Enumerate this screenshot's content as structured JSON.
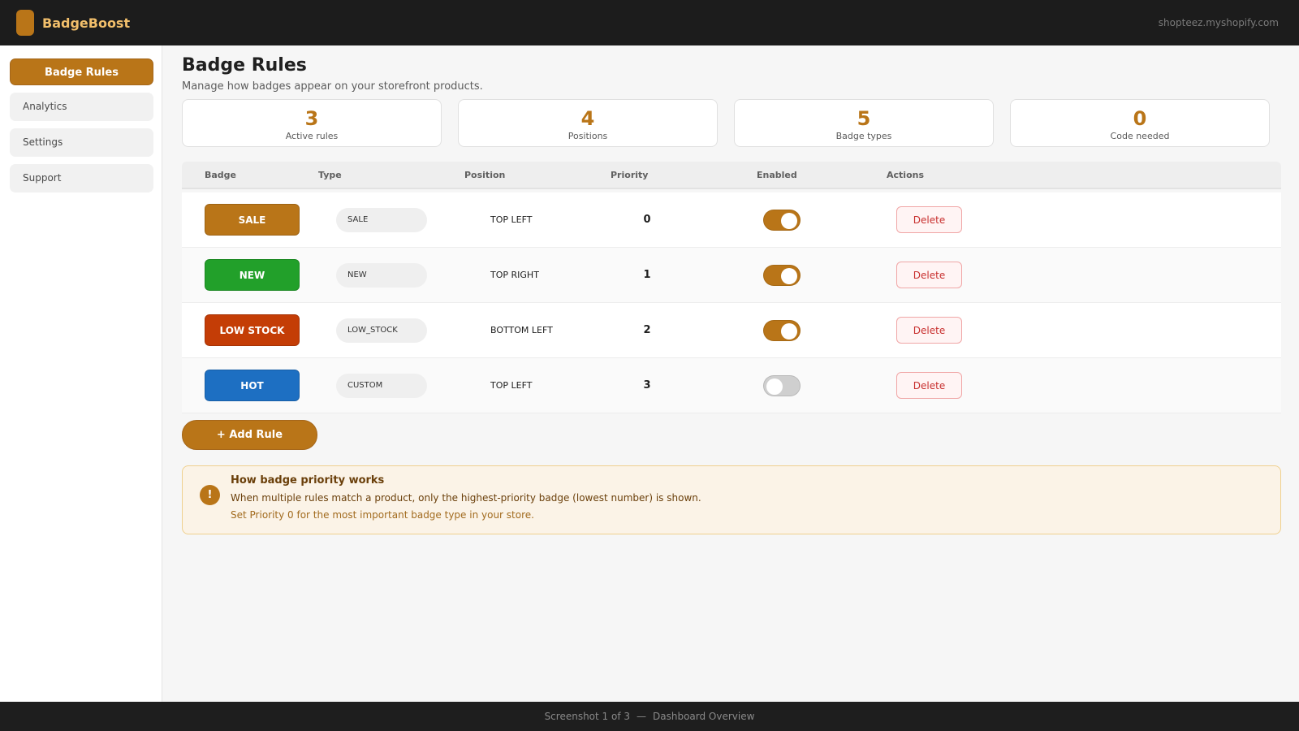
{
  "app": {
    "name": "BadgeBoost",
    "shop_domain": "shopteez.myshopify.com"
  },
  "sidebar": {
    "items": [
      {
        "label": "Badge Rules",
        "active": true
      },
      {
        "label": "Analytics",
        "active": false
      },
      {
        "label": "Settings",
        "active": false
      },
      {
        "label": "Support",
        "active": false
      }
    ]
  },
  "page": {
    "title": "Badge Rules",
    "subtitle": "Manage how badges appear on your storefront products."
  },
  "stats": [
    {
      "value": "3",
      "label": "Active rules"
    },
    {
      "value": "4",
      "label": "Positions"
    },
    {
      "value": "5",
      "label": "Badge types"
    },
    {
      "value": "0",
      "label": "Code needed"
    }
  ],
  "table": {
    "headers": {
      "badge": "Badge",
      "type": "Type",
      "position": "Position",
      "priority": "Priority",
      "enabled": "Enabled",
      "actions": "Actions"
    },
    "rows": [
      {
        "badge": "SALE",
        "color": "#b97518",
        "type": "SALE",
        "position": "TOP LEFT",
        "priority": "0",
        "enabled": true,
        "action": "Delete"
      },
      {
        "badge": "NEW",
        "color": "#22a02a",
        "type": "NEW",
        "position": "TOP RIGHT",
        "priority": "1",
        "enabled": true,
        "action": "Delete"
      },
      {
        "badge": "LOW STOCK",
        "color": "#c43d06",
        "type": "LOW_STOCK",
        "position": "BOTTOM LEFT",
        "priority": "2",
        "enabled": true,
        "action": "Delete"
      },
      {
        "badge": "HOT",
        "color": "#1d6fc2",
        "type": "CUSTOM",
        "position": "TOP LEFT",
        "priority": "3",
        "enabled": false,
        "action": "Delete"
      }
    ]
  },
  "add_button": {
    "label": "+ Add Rule"
  },
  "info": {
    "icon": "!",
    "title": "How badge priority works",
    "text": "When multiple rules match a product, only the highest-priority badge (lowest number) is shown.",
    "sub": "Set Priority 0 for the most important badge type in your store."
  },
  "footer": {
    "left": "Screenshot 1 of 3",
    "separator": "—",
    "right": "Dashboard Overview"
  },
  "colors": {
    "accent": "#b97518",
    "brand_text": "#f2bf6b",
    "danger": "#c8302f"
  }
}
